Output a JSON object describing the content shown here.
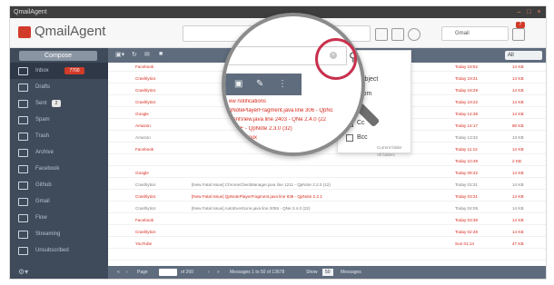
{
  "window": {
    "title": "QmailAgent"
  },
  "header": {
    "app_name": "QmailAgent",
    "account_label": "Gmail",
    "badge": "7"
  },
  "sidebar": {
    "compose_label": "Compose",
    "folders": [
      {
        "label": "Inbox",
        "count": "7700"
      },
      {
        "label": "Drafts"
      },
      {
        "label": "Sent",
        "count": "2"
      },
      {
        "label": "Spam"
      },
      {
        "label": "Trash"
      },
      {
        "label": "Archive"
      },
      {
        "label": "Facebook"
      },
      {
        "label": "Github"
      },
      {
        "label": "Gmail"
      },
      {
        "label": "Flow"
      },
      {
        "label": "Streaming"
      },
      {
        "label": "Unsubscribed"
      }
    ]
  },
  "toolbar": {
    "filter_label": "All"
  },
  "messages": [
    {
      "from": "Facebook",
      "subject": "",
      "date": "Today 19:52",
      "size": "14 KB",
      "unread": true
    },
    {
      "from": "Crashlytics",
      "subject": "",
      "date": "Today 19:31",
      "size": "14 KB",
      "unread": true
    },
    {
      "from": "Crashlytics",
      "subject": "",
      "date": "Today 19:29",
      "size": "14 KB",
      "unread": true
    },
    {
      "from": "Crashlytics",
      "subject": "",
      "date": "Today 19:22",
      "size": "14 KB",
      "unread": true
    },
    {
      "from": "Google",
      "subject": "",
      "date": "Today 14:38",
      "size": "14 KB",
      "unread": true
    },
    {
      "from": "Amazon",
      "subject": "",
      "date": "Today 14:17",
      "size": "80 KB",
      "unread": true
    },
    {
      "from": "Amazon",
      "subject": "",
      "date": "Today 13:32",
      "size": "13 KB",
      "unread": false
    },
    {
      "from": "Facebook",
      "subject": "",
      "date": "Today 11:12",
      "size": "14 KB",
      "unread": true
    },
    {
      "from": "",
      "subject": "",
      "date": "Today 10:48",
      "size": "2 KB",
      "unread": true
    },
    {
      "from": "Google",
      "subject": "",
      "date": "Today 09:42",
      "size": "14 KB",
      "unread": true
    },
    {
      "from": "Crashlytics",
      "subject": "[New Fatal Issue] ChromeClientManager.java line 1211 - QpNote 2.2.0 (12)",
      "date": "Today 03:31",
      "size": "14 KB",
      "unread": false
    },
    {
      "from": "Crashlytics",
      "subject": "[New Fatal Issue] QpNotePlayerFragment.java line 836 - QpNote 2.2.1",
      "date": "Today 03:31",
      "size": "14 KB",
      "unread": true
    },
    {
      "from": "Crashlytics",
      "subject": "[New Fatal Issue] AutoEventLine.java line 2055 - QNe 2.4.0 (22)",
      "date": "Today 04:05",
      "size": "14 KB",
      "unread": false
    },
    {
      "from": "Facebook",
      "subject": "",
      "date": "Today 03:38",
      "size": "14 KB",
      "unread": true
    },
    {
      "from": "Crashlytics",
      "subject": "",
      "date": "Today 02:46",
      "size": "14 KB",
      "unread": true
    },
    {
      "from": "YouTube",
      "subject": "",
      "date": "Sun 01:14",
      "size": "47 KB",
      "unread": true
    },
    {
      "from": "",
      "subject": "",
      "date": "",
      "size": "",
      "unread": true
    }
  ],
  "pager": {
    "page_label": "Page",
    "of_label": "of 260",
    "messages_label": "Messages 1 to 50 of 13678",
    "show_label": "Show",
    "show_value": "50",
    "show_suffix": "Messages"
  },
  "magnifier": {
    "rows": [
      "ew notifications",
      "gNotePlayerFragment.java line 306 - QpNc",
      "wentView.java line 2403 - QNe 2.4.0 (22",
      "ue RF - QpNote 2.3.0 (32)",
      "ed on Linux",
      "201"
    ]
  },
  "search_options": {
    "items": [
      "Subject",
      "From",
      "To",
      "Cc",
      "Bcc"
    ],
    "note_1": "Current folder",
    "note_2": "All folders"
  }
}
